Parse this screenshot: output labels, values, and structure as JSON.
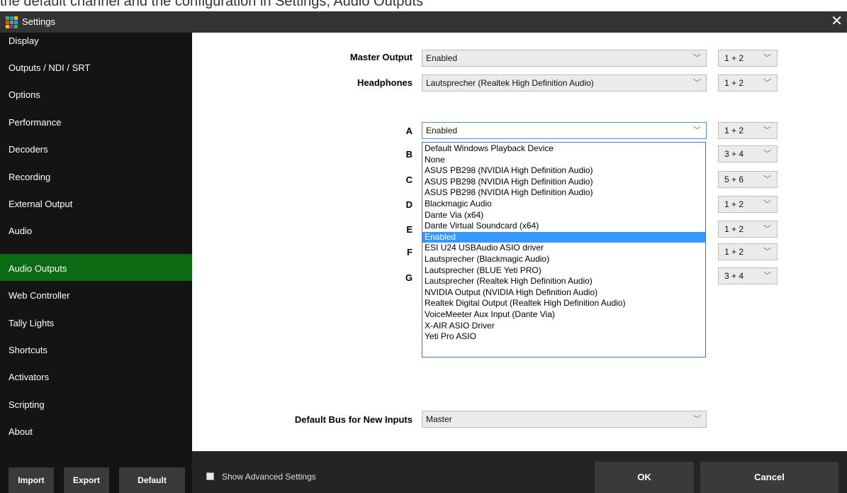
{
  "caption": "the default channel and the configuration in Settings, Audio Outputs",
  "window": {
    "title": "Settings",
    "close_glyph": "✕"
  },
  "sidebar": {
    "items": [
      {
        "label": "Display"
      },
      {
        "label": "Outputs / NDI / SRT"
      },
      {
        "label": "Options"
      },
      {
        "label": "Performance"
      },
      {
        "label": "Decoders"
      },
      {
        "label": "Recording"
      },
      {
        "label": "External Output"
      },
      {
        "label": "Audio"
      },
      {
        "label": "Audio Outputs",
        "active": true
      },
      {
        "label": "Web Controller"
      },
      {
        "label": "Tally Lights"
      },
      {
        "label": "Shortcuts"
      },
      {
        "label": "Activators"
      },
      {
        "label": "Scripting"
      },
      {
        "label": "About"
      }
    ],
    "active_color": "#0a6b12"
  },
  "outputs": {
    "master": {
      "label": "Master Output",
      "value": "Enabled",
      "channel": "1 + 2"
    },
    "headphones": {
      "label": "Headphones",
      "value": "Lautsprecher (Realtek High Definition Audio)",
      "channel": "1 + 2"
    },
    "buses": [
      {
        "label": "A",
        "value": "Enabled",
        "channel": "1 + 2"
      },
      {
        "label": "B",
        "channel": "3 + 4"
      },
      {
        "label": "C",
        "channel": "5 + 6"
      },
      {
        "label": "D",
        "channel": "1 + 2"
      },
      {
        "label": "E",
        "channel": "1 + 2"
      },
      {
        "label": "F",
        "channel": "1 + 2"
      },
      {
        "label": "G",
        "channel": "3 + 4"
      }
    ],
    "default_bus": {
      "label": "Default Bus for New Inputs",
      "value": "Master"
    }
  },
  "dropdown": {
    "options": [
      "Default Windows Playback Device",
      "None",
      "ASUS PB298 (NVIDIA High Definition Audio)",
      "ASUS PB298 (NVIDIA High Definition Audio)",
      "ASUS PB298 (NVIDIA High Definition Audio)",
      "Blackmagic Audio",
      "Dante Via (x64)",
      "Dante Virtual Soundcard (x64)",
      "Enabled",
      "ESI U24 USBAudio ASIO driver",
      "Lautsprecher (Blackmagic Audio)",
      "Lautsprecher (BLUE Yeti PRO)",
      "Lautsprecher (Realtek High Definition Audio)",
      "NVIDIA Output (NVIDIA High Definition Audio)",
      "Realtek Digital Output (Realtek High Definition Audio)",
      "VoiceMeeter Aux Input (Dante Via)",
      "X-AIR ASIO Driver",
      "Yeti Pro ASIO"
    ],
    "selected": "Enabled",
    "highlight_color": "#3399ff"
  },
  "footer": {
    "import": "Import",
    "export": "Export",
    "default": "Default",
    "show_advanced": "Show Advanced Settings",
    "ok": "OK",
    "cancel": "Cancel"
  },
  "icons": {
    "dropdown": "chevron-down-icon",
    "app": "app-grid-icon",
    "close": "close-icon"
  }
}
